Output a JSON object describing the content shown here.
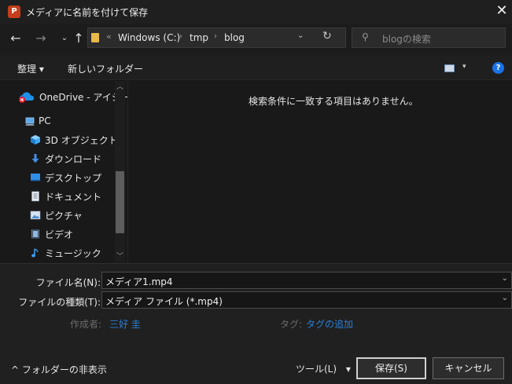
{
  "titlebar": {
    "app_icon_letter": "P",
    "title": "メディアに名前を付けて保存",
    "close_glyph": "✕"
  },
  "navbar": {
    "back_glyph": "←",
    "forward_glyph": "→",
    "recent_glyph": "⌄",
    "up_glyph": "↑",
    "overflow_glyph": "«",
    "breadcrumbs": [
      "Windows (C:)",
      "tmp",
      "blog"
    ],
    "separator": "›",
    "dropdown_glyph": "⌄",
    "refresh_glyph": "↻",
    "search_glyph": "⚲",
    "search_placeholder": "blogの検索"
  },
  "toolbar": {
    "organize_label": "整理 ▾",
    "new_folder_label": "新しいフォルダー",
    "view_chevron": "▾",
    "help_glyph": "?"
  },
  "sidebar": {
    "scroll_up": "︿",
    "scroll_down": "﹀",
    "items": [
      {
        "label": "OneDrive - アイシー",
        "icon": "onedrive-icon"
      },
      {
        "label": "PC",
        "icon": "pc-icon"
      },
      {
        "label": "3D オブジェクト",
        "icon": "3d-objects-icon"
      },
      {
        "label": "ダウンロード",
        "icon": "download-icon"
      },
      {
        "label": "デスクトップ",
        "icon": "desktop-icon"
      },
      {
        "label": "ドキュメント",
        "icon": "documents-icon"
      },
      {
        "label": "ピクチャ",
        "icon": "pictures-icon"
      },
      {
        "label": "ビデオ",
        "icon": "videos-icon"
      },
      {
        "label": "ミュージック",
        "icon": "music-icon"
      }
    ]
  },
  "content": {
    "empty_message": "検索条件に一致する項目はありません。"
  },
  "form": {
    "filename_label": "ファイル名(N):",
    "filename_value": "メディア1.mp4",
    "filetype_label": "ファイルの種類(T):",
    "filetype_value": "メディア ファイル (*.mp4)",
    "chev": "⌄",
    "author_label": "作成者:",
    "author_value": "三好 圭",
    "tags_label": "タグ:",
    "tags_value": "タグの追加"
  },
  "footer": {
    "hide_folders_label": "フォルダーの非表示",
    "hide_glyph": "^",
    "tools_label": "ツール(L)",
    "tools_glyph": "▾",
    "save_label": "保存(S)",
    "cancel_label": "キャンセル"
  },
  "colors": {
    "accent": "#2c7fd6",
    "background": "#191919"
  }
}
